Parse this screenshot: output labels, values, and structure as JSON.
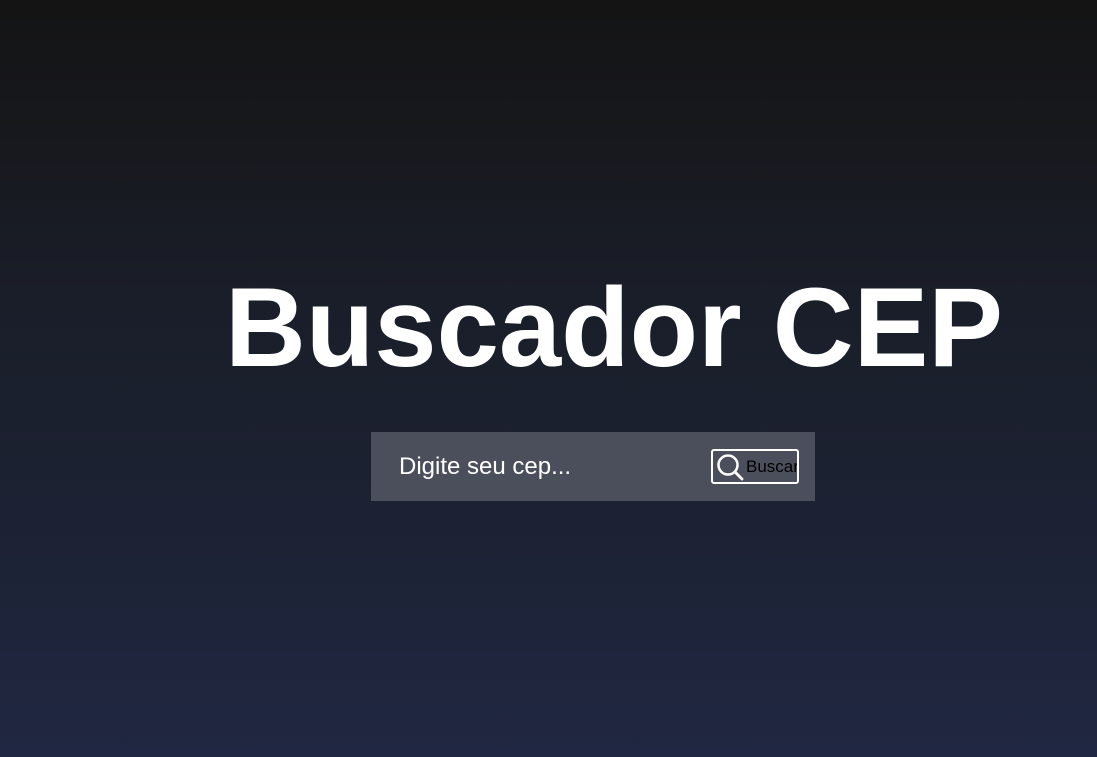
{
  "page": {
    "title": "Buscador CEP"
  },
  "search": {
    "placeholder": "Digite seu cep...",
    "value": "",
    "button_label": "Buscar",
    "button_icon": "search-icon"
  },
  "colors": {
    "background_top": "#141414",
    "background_bottom": "#202742",
    "search_bar": "#4b4f5b",
    "title_text": "#ffffff"
  }
}
